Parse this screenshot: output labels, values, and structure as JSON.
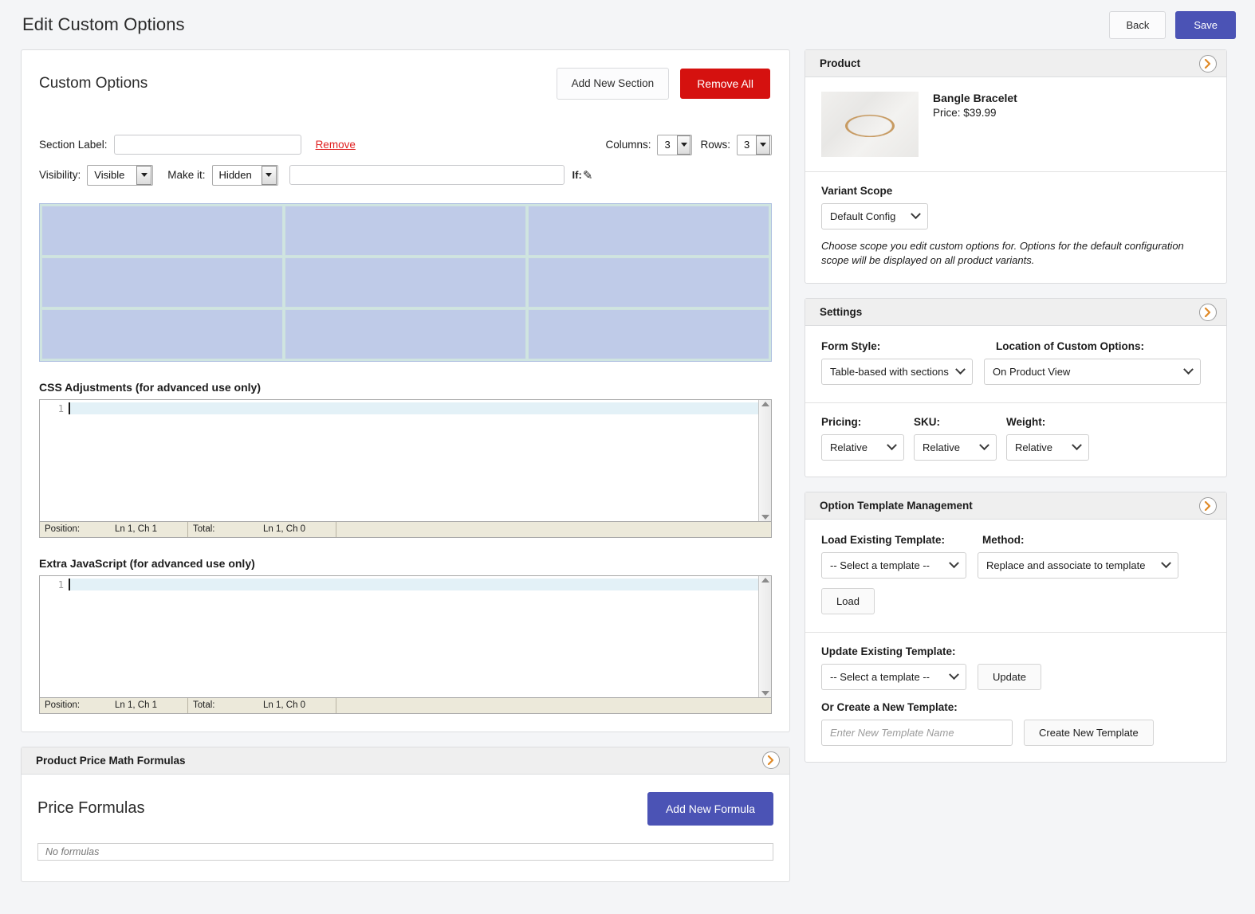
{
  "header": {
    "title": "Edit Custom Options",
    "back_label": "Back",
    "save_label": "Save"
  },
  "custom_options": {
    "title": "Custom Options",
    "add_new_section_label": "Add New Section",
    "remove_all_label": "Remove All",
    "section": {
      "section_label_label": "Section Label:",
      "section_label_value": "",
      "remove_link": "Remove",
      "columns_label": "Columns:",
      "columns_value": "3",
      "rows_label": "Rows:",
      "rows_value": "3",
      "visibility_label": "Visibility:",
      "visibility_value": "Visible",
      "make_it_label": "Make it:",
      "make_it_value": "Hidden",
      "condition_value": "",
      "if_label": "If:",
      "pencil_icon": "pencil-icon"
    },
    "grid": {
      "columns": 3,
      "rows": 3,
      "cells": [
        "",
        "",
        "",
        "",
        "",
        "",
        "",
        "",
        ""
      ],
      "cell_color": "#bfcbe8",
      "border_color": "#aebfe0"
    },
    "css_editor": {
      "label": "CSS Adjustments (for advanced use only)",
      "line_numbers": [
        "1"
      ],
      "content": "",
      "status": {
        "position_key": "Position:",
        "position_value": "Ln 1, Ch 1",
        "total_key": "Total:",
        "total_value": "Ln 1, Ch 0"
      }
    },
    "js_editor": {
      "label": "Extra JavaScript (for advanced use only)",
      "line_numbers": [
        "1"
      ],
      "content": "",
      "status": {
        "position_key": "Position:",
        "position_value": "Ln 1, Ch 1",
        "total_key": "Total:",
        "total_value": "Ln 1, Ch 0"
      }
    }
  },
  "price_formulas_panel": {
    "panel_title": "Product Price Math Formulas",
    "title": "Price Formulas",
    "add_new_formula_label": "Add New Formula",
    "empty_text": "No formulas"
  },
  "product_panel": {
    "panel_title": "Product",
    "name": "Bangle Bracelet",
    "price": "Price: $39.99",
    "variant_scope_label": "Variant Scope",
    "variant_scope_value": "Default Config",
    "help_text": "Choose scope you edit custom options for. Options for the default configuration scope will be displayed on all product variants."
  },
  "settings_panel": {
    "panel_title": "Settings",
    "form_style_label": "Form Style:",
    "form_style_value": "Table-based with sections",
    "location_label": "Location of Custom Options:",
    "location_value": "On Product View",
    "pricing_label": "Pricing:",
    "pricing_value": "Relative",
    "sku_label": "SKU:",
    "sku_value": "Relative",
    "weight_label": "Weight:",
    "weight_value": "Relative"
  },
  "template_panel": {
    "panel_title": "Option Template Management",
    "load_label": "Load Existing Template:",
    "load_value": "-- Select a template --",
    "method_label": "Method:",
    "method_value": "Replace and associate to template",
    "load_button": "Load",
    "update_label": "Update Existing Template:",
    "update_value": "-- Select a template --",
    "update_button": "Update",
    "create_label": "Or Create a New Template:",
    "create_placeholder": "Enter New Template Name",
    "create_button": "Create New Template"
  },
  "colors": {
    "primary": "#4b53b5",
    "danger": "#d5110f",
    "link": "#e02020",
    "grid_cell": "#bfcbe8"
  }
}
